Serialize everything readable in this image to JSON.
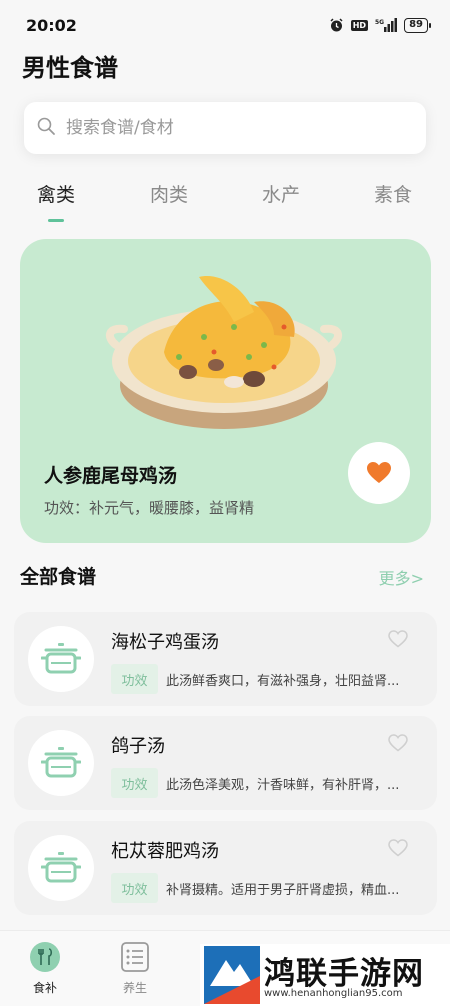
{
  "status_bar": {
    "time": "20:02",
    "network": "5G",
    "hd": "HD",
    "battery": "89"
  },
  "page": {
    "title": "男性食谱"
  },
  "search": {
    "placeholder": "搜索食谱/食材"
  },
  "tabs": [
    {
      "label": "禽类",
      "active": true
    },
    {
      "label": "肉类",
      "active": false
    },
    {
      "label": "水产",
      "active": false
    },
    {
      "label": "素食",
      "active": false
    }
  ],
  "featured": {
    "title": "人参鹿尾母鸡汤",
    "subtitle": "功效：补元气，暖腰膝，益肾精",
    "favorite_icon": "heart-icon",
    "accent": "#f07a2c"
  },
  "section": {
    "title": "全部食谱",
    "more": "更多>"
  },
  "recipes": [
    {
      "name": "海松子鸡蛋汤",
      "tag": "功效",
      "desc": "此汤鲜香爽口，有滋补强身，壮阳益肾..."
    },
    {
      "name": "鸽子汤",
      "tag": "功效",
      "desc": "此汤色泽美观，汁香味鲜，有补肝肾，..."
    },
    {
      "name": "杞苁蓉肥鸡汤",
      "tag": "功效",
      "desc": "补肾摄精。适用于男子肝肾虚损，精血..."
    }
  ],
  "bottom_nav": [
    {
      "label": "食补",
      "icon": "food-icon",
      "active": true
    },
    {
      "label": "养生",
      "icon": "list-icon",
      "active": false
    }
  ],
  "watermark": {
    "name": "鸿联手游网",
    "url": "www.henanhonglian95.com"
  },
  "colors": {
    "green": "#5fc29a",
    "hero_bg": "#c7ead0",
    "tag_bg": "#e3f1e7"
  }
}
